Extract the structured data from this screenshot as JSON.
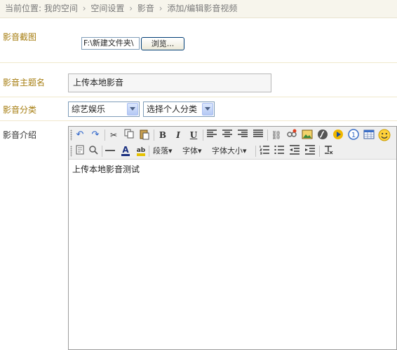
{
  "breadcrumb": {
    "prefix": "当前位置:",
    "items": [
      "我的空间",
      "空间设置",
      "影音",
      "添加/编辑影音视频"
    ],
    "separator": "›"
  },
  "form": {
    "screenshot_label": "影音截图",
    "file_value": "F:\\新建文件夹\\",
    "browse_label": "浏览...",
    "title_label": "影音主题名",
    "title_value": "上传本地影音",
    "category_label": "影音分类",
    "category_value": "综艺娱乐",
    "personal_category_value": "选择个人分类",
    "intro_label": "影音介绍"
  },
  "editor": {
    "content": "上传本地影音测试",
    "toolbar": {
      "bold": "B",
      "italic": "I",
      "underline": "U",
      "paragraph": "段落",
      "font": "字体",
      "font_size": "字体大小"
    }
  },
  "colors": {
    "label": "#a67d10",
    "breadcrumb_bg": "#f7f5ec",
    "divider": "#f0e8cc",
    "toolbar_bg": "#efefef"
  }
}
